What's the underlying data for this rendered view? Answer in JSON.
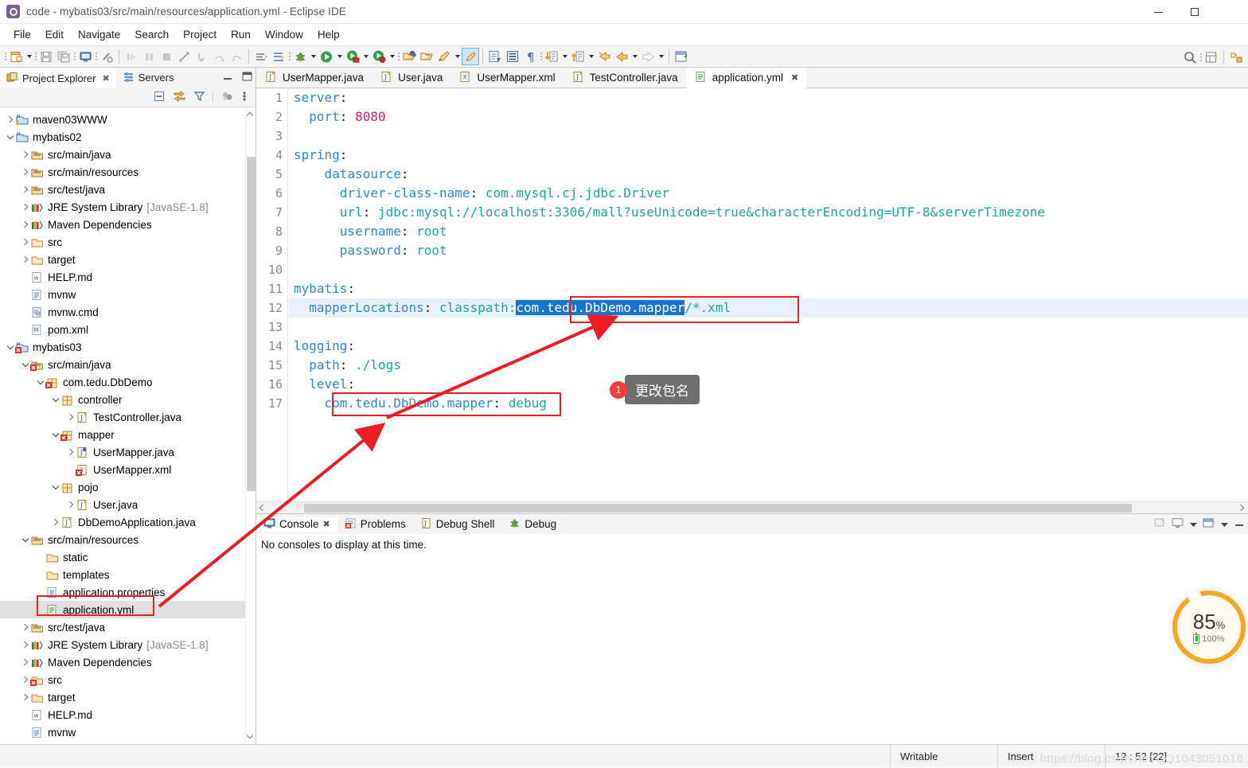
{
  "window": {
    "title": "code - mybatis03/src/main/resources/application.yml - Eclipse IDE",
    "app_icon": "eclipse-icon",
    "minimize": "–",
    "maximize": "□",
    "close": "✕"
  },
  "menu": [
    "File",
    "Edit",
    "Navigate",
    "Search",
    "Project",
    "Run",
    "Window",
    "Help"
  ],
  "project_explorer": {
    "tabs": [
      {
        "label": "Project Explorer",
        "icon": "project-explorer-icon",
        "active": true,
        "closable": true
      },
      {
        "label": "Servers",
        "icon": "servers-icon",
        "active": false,
        "closable": false
      }
    ],
    "view_buttons": [
      "collapse-all-icon",
      "link-with-editor-icon",
      "view-menu-filter-icon",
      "focus-icon",
      "view-menu-icon"
    ],
    "tree": [
      {
        "label": "maven03WWW",
        "indent": 0,
        "twisty": "right",
        "icon": "maven-project-warn-icon"
      },
      {
        "label": "mybatis02",
        "indent": 0,
        "twisty": "down",
        "icon": "maven-project-icon"
      },
      {
        "label": "src/main/java",
        "indent": 1,
        "twisty": "right",
        "icon": "source-folder-icon"
      },
      {
        "label": "src/main/resources",
        "indent": 1,
        "twisty": "right",
        "icon": "source-folder-icon"
      },
      {
        "label": "src/test/java",
        "indent": 1,
        "twisty": "right",
        "icon": "source-folder-icon"
      },
      {
        "label": "JRE System Library",
        "sub": "[JavaSE-1.8]",
        "indent": 1,
        "twisty": "right",
        "icon": "library-icon"
      },
      {
        "label": "Maven Dependencies",
        "indent": 1,
        "twisty": "right",
        "icon": "library-icon"
      },
      {
        "label": "src",
        "indent": 1,
        "twisty": "right",
        "icon": "folder-icon"
      },
      {
        "label": "target",
        "indent": 1,
        "twisty": "right",
        "icon": "folder-icon"
      },
      {
        "label": "HELP.md",
        "indent": 1,
        "twisty": "none",
        "icon": "markdown-file-icon"
      },
      {
        "label": "mvnw",
        "indent": 1,
        "twisty": "none",
        "icon": "text-file-icon"
      },
      {
        "label": "mvnw.cmd",
        "indent": 1,
        "twisty": "none",
        "icon": "cmd-file-icon"
      },
      {
        "label": "pom.xml",
        "indent": 1,
        "twisty": "none",
        "icon": "maven-pom-icon"
      },
      {
        "label": "mybatis03",
        "indent": 0,
        "twisty": "down",
        "icon": "maven-project-error-icon"
      },
      {
        "label": "src/main/java",
        "indent": 1,
        "twisty": "down",
        "icon": "source-folder-error-icon"
      },
      {
        "label": "com.tedu.DbDemo",
        "indent": 2,
        "twisty": "down",
        "icon": "package-error-icon"
      },
      {
        "label": "controller",
        "indent": 3,
        "twisty": "down",
        "icon": "package-icon"
      },
      {
        "label": "TestController.java",
        "indent": 4,
        "twisty": "right",
        "icon": "java-file-icon"
      },
      {
        "label": "mapper",
        "indent": 3,
        "twisty": "down",
        "icon": "package-error-icon"
      },
      {
        "label": "UserMapper.java",
        "indent": 4,
        "twisty": "right",
        "icon": "java-interface-icon"
      },
      {
        "label": "UserMapper.xml",
        "indent": 4,
        "twisty": "none",
        "icon": "xml-file-error-icon"
      },
      {
        "label": "pojo",
        "indent": 3,
        "twisty": "down",
        "icon": "package-icon"
      },
      {
        "label": "User.java",
        "indent": 4,
        "twisty": "right",
        "icon": "java-file-icon"
      },
      {
        "label": "DbDemoApplication.java",
        "indent": 3,
        "twisty": "right",
        "icon": "java-file-icon"
      },
      {
        "label": "src/main/resources",
        "indent": 1,
        "twisty": "down",
        "icon": "source-folder-icon"
      },
      {
        "label": "static",
        "indent": 2,
        "twisty": "none",
        "icon": "folder-icon"
      },
      {
        "label": "templates",
        "indent": 2,
        "twisty": "none",
        "icon": "folder-icon"
      },
      {
        "label": "application.properties",
        "indent": 2,
        "twisty": "none",
        "icon": "text-file-icon"
      },
      {
        "label": "application.yml",
        "indent": 2,
        "twisty": "none",
        "icon": "yaml-file-icon",
        "selected": true
      },
      {
        "label": "src/test/java",
        "indent": 1,
        "twisty": "right",
        "icon": "source-folder-icon"
      },
      {
        "label": "JRE System Library",
        "sub": "[JavaSE-1.8]",
        "indent": 1,
        "twisty": "right",
        "icon": "library-icon"
      },
      {
        "label": "Maven Dependencies",
        "indent": 1,
        "twisty": "right",
        "icon": "library-icon"
      },
      {
        "label": "src",
        "indent": 1,
        "twisty": "right",
        "icon": "folder-error-icon"
      },
      {
        "label": "target",
        "indent": 1,
        "twisty": "right",
        "icon": "folder-icon"
      },
      {
        "label": "HELP.md",
        "indent": 1,
        "twisty": "none",
        "icon": "markdown-file-icon"
      },
      {
        "label": "mvnw",
        "indent": 1,
        "twisty": "none",
        "icon": "text-file-icon"
      }
    ]
  },
  "editor": {
    "tabs": [
      {
        "label": "UserMapper.java",
        "icon": "java-file-icon",
        "active": false
      },
      {
        "label": "User.java",
        "icon": "java-file-icon",
        "active": false
      },
      {
        "label": "UserMapper.xml",
        "icon": "xml-file-icon",
        "active": false
      },
      {
        "label": "TestController.java",
        "icon": "java-file-icon",
        "active": false
      },
      {
        "label": "application.yml",
        "icon": "yaml-file-icon",
        "active": true,
        "closable": true
      }
    ],
    "lines": [
      {
        "n": 1,
        "tokens": [
          {
            "t": "server",
            "c": "k"
          },
          {
            "t": ":",
            "c": "p"
          }
        ]
      },
      {
        "n": 2,
        "tokens": [
          {
            "t": "  ",
            "c": "p"
          },
          {
            "t": "port",
            "c": "k"
          },
          {
            "t": ": ",
            "c": "p"
          },
          {
            "t": "8080",
            "c": "num"
          }
        ]
      },
      {
        "n": 3,
        "tokens": []
      },
      {
        "n": 4,
        "tokens": [
          {
            "t": "spring",
            "c": "k"
          },
          {
            "t": ":",
            "c": "p"
          }
        ]
      },
      {
        "n": 5,
        "tokens": [
          {
            "t": "    ",
            "c": "p"
          },
          {
            "t": "datasource",
            "c": "k"
          },
          {
            "t": ":",
            "c": "p"
          }
        ]
      },
      {
        "n": 6,
        "tokens": [
          {
            "t": "      ",
            "c": "p"
          },
          {
            "t": "driver-class-name",
            "c": "k"
          },
          {
            "t": ": ",
            "c": "p"
          },
          {
            "t": "com.mysql.cj.jdbc.Driver",
            "c": "v"
          }
        ]
      },
      {
        "n": 7,
        "tokens": [
          {
            "t": "      ",
            "c": "p"
          },
          {
            "t": "url",
            "c": "k"
          },
          {
            "t": ": ",
            "c": "p"
          },
          {
            "t": "jdbc:mysql://localhost:3306/mall?useUnicode=true&characterEncoding=UTF-8&serverTimezone",
            "c": "v"
          }
        ]
      },
      {
        "n": 8,
        "tokens": [
          {
            "t": "      ",
            "c": "p"
          },
          {
            "t": "username",
            "c": "k"
          },
          {
            "t": ": ",
            "c": "p"
          },
          {
            "t": "root",
            "c": "v"
          }
        ]
      },
      {
        "n": 9,
        "tokens": [
          {
            "t": "      ",
            "c": "p"
          },
          {
            "t": "password",
            "c": "k"
          },
          {
            "t": ": ",
            "c": "p"
          },
          {
            "t": "root",
            "c": "v"
          }
        ]
      },
      {
        "n": 10,
        "tokens": []
      },
      {
        "n": 11,
        "tokens": [
          {
            "t": "mybatis",
            "c": "k"
          },
          {
            "t": ":",
            "c": "p"
          }
        ]
      },
      {
        "n": 12,
        "highlight": true,
        "tokens": [
          {
            "t": "  ",
            "c": "p"
          },
          {
            "t": "mapperLocations",
            "c": "k"
          },
          {
            "t": ": ",
            "c": "p"
          },
          {
            "t": "classpath:",
            "c": "v"
          },
          {
            "t": "com.tedu.DbDemo.mapper",
            "c": "selhl"
          },
          {
            "t": "/*.xml",
            "c": "v"
          }
        ]
      },
      {
        "n": 13,
        "tokens": []
      },
      {
        "n": 14,
        "tokens": [
          {
            "t": "logging",
            "c": "k"
          },
          {
            "t": ":",
            "c": "p"
          }
        ]
      },
      {
        "n": 15,
        "tokens": [
          {
            "t": "  ",
            "c": "p"
          },
          {
            "t": "path",
            "c": "k"
          },
          {
            "t": ": ",
            "c": "p"
          },
          {
            "t": "./logs",
            "c": "v"
          }
        ]
      },
      {
        "n": 16,
        "tokens": [
          {
            "t": "  ",
            "c": "p"
          },
          {
            "t": "level",
            "c": "k"
          },
          {
            "t": ":",
            "c": "p"
          }
        ]
      },
      {
        "n": 17,
        "tokens": [
          {
            "t": "    ",
            "c": "p"
          },
          {
            "t": "com.tedu.DbDemo.mapper",
            "c": "k"
          },
          {
            "t": ": ",
            "c": "p"
          },
          {
            "t": "debug",
            "c": "v"
          }
        ]
      }
    ]
  },
  "console": {
    "tabs": [
      {
        "label": "Console",
        "icon": "console-icon",
        "active": true,
        "closable": true
      },
      {
        "label": "Problems",
        "icon": "problems-icon",
        "active": false
      },
      {
        "label": "Debug Shell",
        "icon": "debug-shell-icon",
        "active": false
      },
      {
        "label": "Debug",
        "icon": "debug-icon",
        "active": false
      }
    ],
    "message": "No consoles to display at this time.",
    "toolbar_icons": [
      "clear-console-icon",
      "display-console-icon",
      "console-dropdown-caret",
      "open-console-icon",
      "open-console-caret",
      "minimize-icon"
    ]
  },
  "statusbar": {
    "writable": "Writable",
    "insert": "Insert",
    "position": "12 : 52 [22]",
    "watermark": "https://blog.csdn.net/QQ1043051018"
  },
  "annotations": {
    "callout_number": "1",
    "callout_text": "更改包名",
    "box_color": "#ee1c25"
  },
  "battery_widget": {
    "percent": "85",
    "percent_symbol": "%",
    "battery_level": "100%"
  }
}
